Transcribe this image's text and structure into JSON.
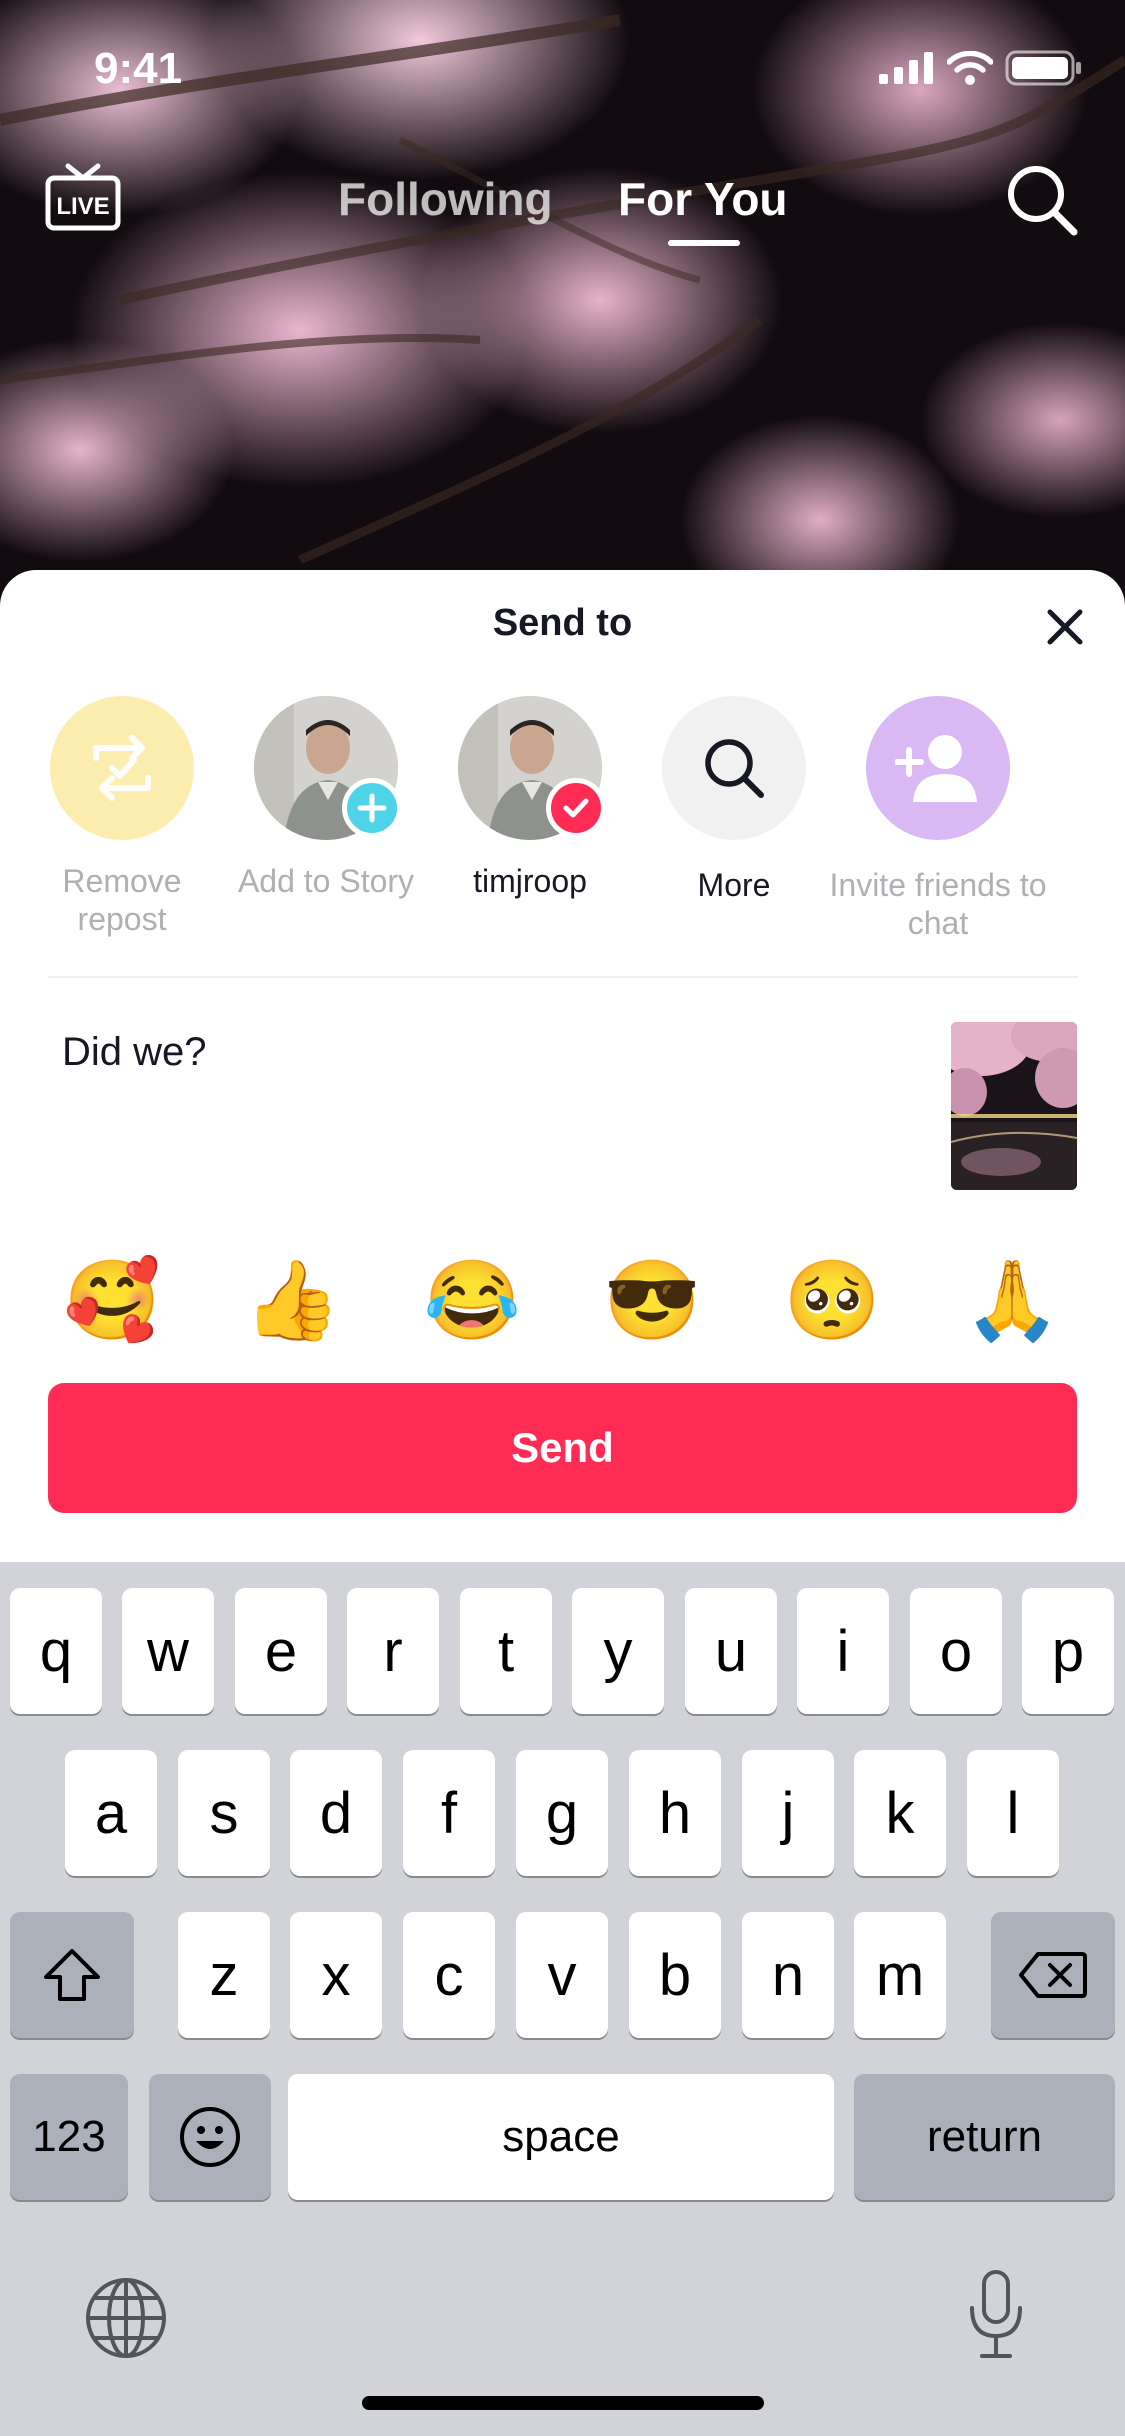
{
  "status_bar": {
    "time": "9:41",
    "icons": [
      "signal-icon",
      "wifi-icon",
      "battery-icon"
    ]
  },
  "top_nav": {
    "live_label": "LIVE",
    "tabs": [
      {
        "label": "Following",
        "active": false
      },
      {
        "label": "For You",
        "active": true
      }
    ]
  },
  "sheet": {
    "title": "Send to",
    "share_items": [
      {
        "label": "Remove repost",
        "icon": "repost-icon",
        "color": "#fdeeb0"
      },
      {
        "label": "Add to Story",
        "icon": "plus-icon",
        "color": "#4fd3e8"
      },
      {
        "label": "timjroop",
        "icon": "checkmark-icon",
        "color": "#fe2c55",
        "selected": true
      },
      {
        "label": "More",
        "icon": "search-icon",
        "color": "#f1f1f2"
      },
      {
        "label": "Invite friends to chat",
        "icon": "add-person-icon",
        "color": "#d9b8f4"
      }
    ],
    "message": "Did we?",
    "emojis": [
      "🥰",
      "👍",
      "😂",
      "😎",
      "🥺",
      "🙏"
    ],
    "send_label": "Send"
  },
  "keyboard": {
    "row1": [
      "q",
      "w",
      "e",
      "r",
      "t",
      "y",
      "u",
      "i",
      "o",
      "p"
    ],
    "row2": [
      "a",
      "s",
      "d",
      "f",
      "g",
      "h",
      "j",
      "k",
      "l"
    ],
    "row3": [
      "z",
      "x",
      "c",
      "v",
      "b",
      "n",
      "m"
    ],
    "numbers_label": "123",
    "space_label": "space",
    "return_label": "return"
  },
  "colors": {
    "accent": "#fe2c55",
    "keyboard_bg": "#d1d3d9",
    "modifier_key": "#abb0ba"
  }
}
